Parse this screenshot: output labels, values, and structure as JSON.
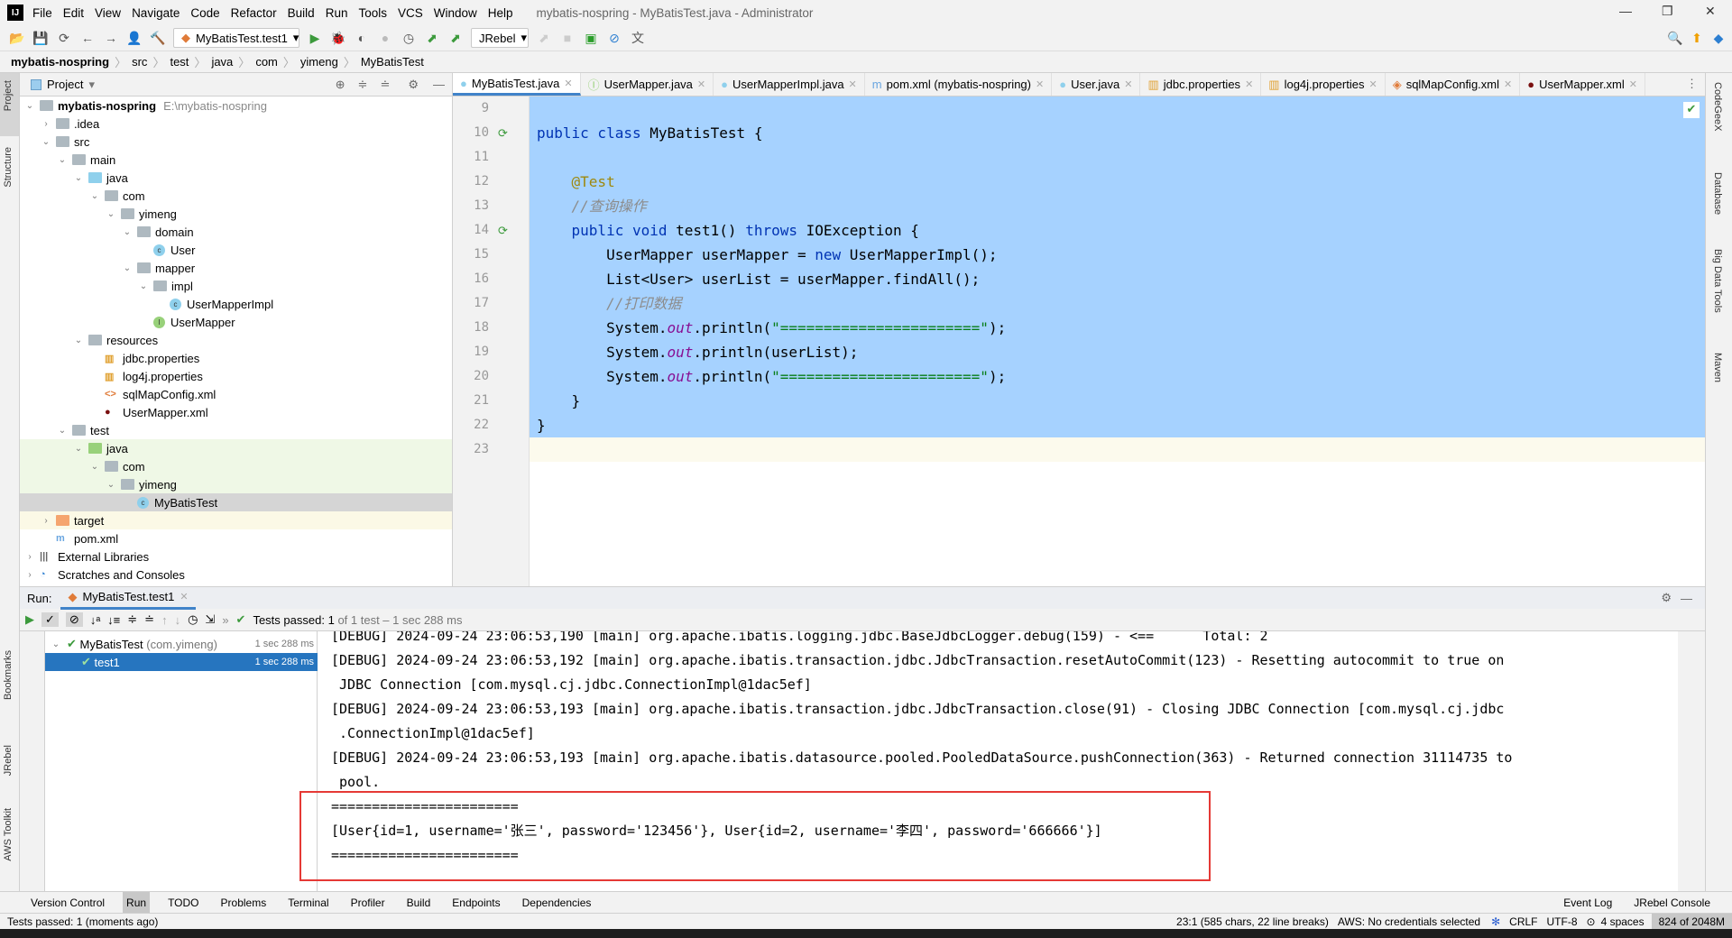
{
  "window": {
    "title": "mybatis-nospring - MyBatisTest.java - Administrator"
  },
  "menu": [
    "File",
    "Edit",
    "View",
    "Navigate",
    "Code",
    "Refactor",
    "Build",
    "Run",
    "Tools",
    "VCS",
    "Window",
    "Help"
  ],
  "toolbar": {
    "run_config": "MyBatisTest.test1",
    "jrebel": "JRebel"
  },
  "breadcrumb": [
    "mybatis-nospring",
    "src",
    "test",
    "java",
    "com",
    "yimeng",
    "MyBatisTest"
  ],
  "project": {
    "header": "Project",
    "tree": [
      {
        "label": "mybatis-nospring",
        "hint": "E:\\mybatis-nospring",
        "depth": 0,
        "icon": "module",
        "open": true
      },
      {
        "label": ".idea",
        "depth": 1,
        "icon": "folder",
        "open": false
      },
      {
        "label": "src",
        "depth": 1,
        "icon": "folder",
        "open": true
      },
      {
        "label": "main",
        "depth": 2,
        "icon": "folder",
        "open": true
      },
      {
        "label": "java",
        "depth": 3,
        "icon": "src-folder",
        "open": true
      },
      {
        "label": "com",
        "depth": 4,
        "icon": "package",
        "open": true
      },
      {
        "label": "yimeng",
        "depth": 5,
        "icon": "package",
        "open": true
      },
      {
        "label": "domain",
        "depth": 6,
        "icon": "package",
        "open": true
      },
      {
        "label": "User",
        "depth": 7,
        "icon": "class"
      },
      {
        "label": "mapper",
        "depth": 6,
        "icon": "package",
        "open": true
      },
      {
        "label": "impl",
        "depth": 7,
        "icon": "package",
        "open": true
      },
      {
        "label": "UserMapperImpl",
        "depth": 8,
        "icon": "class"
      },
      {
        "label": "UserMapper",
        "depth": 7,
        "icon": "interface"
      },
      {
        "label": "resources",
        "depth": 3,
        "icon": "res-folder",
        "open": true
      },
      {
        "label": "jdbc.properties",
        "depth": 4,
        "icon": "properties"
      },
      {
        "label": "log4j.properties",
        "depth": 4,
        "icon": "properties"
      },
      {
        "label": "sqlMapConfig.xml",
        "depth": 4,
        "icon": "xml"
      },
      {
        "label": "UserMapper.xml",
        "depth": 4,
        "icon": "mybatis-xml"
      },
      {
        "label": "test",
        "depth": 2,
        "icon": "folder",
        "open": true
      },
      {
        "label": "java",
        "depth": 3,
        "icon": "test-folder",
        "open": true,
        "bg": "#eff8e6"
      },
      {
        "label": "com",
        "depth": 4,
        "icon": "package",
        "open": true,
        "bg": "#eff8e6"
      },
      {
        "label": "yimeng",
        "depth": 5,
        "icon": "package",
        "open": true,
        "bg": "#eff8e6"
      },
      {
        "label": "MyBatisTest",
        "depth": 6,
        "icon": "test-class",
        "bg": "#d5d5d5"
      },
      {
        "label": "target",
        "depth": 1,
        "icon": "excluded-folder",
        "open": false,
        "bg": "#fbf9e6"
      },
      {
        "label": "pom.xml",
        "depth": 1,
        "icon": "maven"
      },
      {
        "label": "External Libraries",
        "depth": 0,
        "icon": "libraries",
        "open": false
      },
      {
        "label": "Scratches and Consoles",
        "depth": 0,
        "icon": "scratches",
        "open": false
      }
    ]
  },
  "tabs": [
    {
      "label": "MyBatisTest.java",
      "icon": "test-class",
      "active": true
    },
    {
      "label": "UserMapper.java",
      "icon": "interface"
    },
    {
      "label": "UserMapperImpl.java",
      "icon": "class"
    },
    {
      "label": "pom.xml (mybatis-nospring)",
      "icon": "maven"
    },
    {
      "label": "User.java",
      "icon": "class"
    },
    {
      "label": "jdbc.properties",
      "icon": "properties"
    },
    {
      "label": "log4j.properties",
      "icon": "properties"
    },
    {
      "label": "sqlMapConfig.xml",
      "icon": "xml"
    },
    {
      "label": "UserMapper.xml",
      "icon": "mybatis-xml"
    }
  ],
  "code": [
    {
      "n": "9",
      "html": ""
    },
    {
      "n": "10",
      "html": "<span class='kw'>public class</span> MyBatisTest {",
      "run": true
    },
    {
      "n": "11",
      "html": ""
    },
    {
      "n": "12",
      "html": "    <span class='ann'>@Test</span>"
    },
    {
      "n": "13",
      "html": "    <span class='cm'>//查询操作</span>"
    },
    {
      "n": "14",
      "html": "    <span class='kw'>public void</span> test1() <span class='kw'>throws</span> IOException {",
      "run": true
    },
    {
      "n": "15",
      "html": "        UserMapper userMapper = <span class='kw'>new</span> UserMapperImpl();"
    },
    {
      "n": "16",
      "html": "        List&lt;User&gt; userList = userMapper.findAll();"
    },
    {
      "n": "17",
      "html": "        <span class='cm'>//打印数据</span>"
    },
    {
      "n": "18",
      "html": "        System.<span class='st'>out</span>.println(<span class='str'>\"=======================\"</span>);"
    },
    {
      "n": "19",
      "html": "        System.<span class='st'>out</span>.println(userList);"
    },
    {
      "n": "20",
      "html": "        System.<span class='st'>out</span>.println(<span class='str'>\"=======================\"</span>);"
    },
    {
      "n": "21",
      "html": "    }"
    },
    {
      "n": "22",
      "html": "}"
    },
    {
      "n": "23",
      "html": ""
    }
  ],
  "right_stripe": [
    "CodeGeeX",
    "Database",
    "Big Data Tools",
    "Maven"
  ],
  "left_stripe": [
    "Project",
    "Structure",
    "Bookmarks",
    "JRebel",
    "AWS Toolkit"
  ],
  "run": {
    "label": "Run:",
    "tab": "MyBatisTest.test1",
    "status_prefix": "Tests passed:",
    "status_count": "1",
    "status_rest": "of 1 test – 1 sec 288 ms",
    "tests": [
      {
        "label": "MyBatisTest",
        "pkg": "(com.yimeng)",
        "time": "1 sec 288 ms"
      },
      {
        "label": "test1",
        "time": "1 sec 288 ms"
      }
    ],
    "console": [
      "[DEBUG] 2024-09-24 23:06:53,190 [main] org.apache.ibatis.logging.jdbc.BaseJdbcLogger.debug(159) - <==      Total: 2",
      "[DEBUG] 2024-09-24 23:06:53,192 [main] org.apache.ibatis.transaction.jdbc.JdbcTransaction.resetAutoCommit(123) - Resetting autocommit to true on",
      " JDBC Connection [com.mysql.cj.jdbc.ConnectionImpl@1dac5ef]",
      "[DEBUG] 2024-09-24 23:06:53,193 [main] org.apache.ibatis.transaction.jdbc.JdbcTransaction.close(91) - Closing JDBC Connection [com.mysql.cj.jdbc",
      " .ConnectionImpl@1dac5ef]",
      "[DEBUG] 2024-09-24 23:06:53,193 [main] org.apache.ibatis.datasource.pooled.PooledDataSource.pushConnection(363) - Returned connection 31114735 to",
      " pool.",
      "=======================",
      "[User{id=1, username='张三', password='123456'}, User{id=2, username='李四', password='666666'}]",
      "======================="
    ]
  },
  "bottom_tools": [
    "Version Control",
    "Run",
    "TODO",
    "Problems",
    "Terminal",
    "Profiler",
    "Build",
    "Endpoints",
    "Dependencies"
  ],
  "bottom_right": [
    "Event Log",
    "JRebel Console"
  ],
  "status": {
    "left": "Tests passed: 1 (moments ago)",
    "position": "23:1 (585 chars, 22 line breaks)",
    "aws": "AWS: No credentials selected",
    "eol": "CRLF",
    "encoding": "UTF-8",
    "indent": "4 spaces",
    "memory": "824 of 2048M"
  }
}
